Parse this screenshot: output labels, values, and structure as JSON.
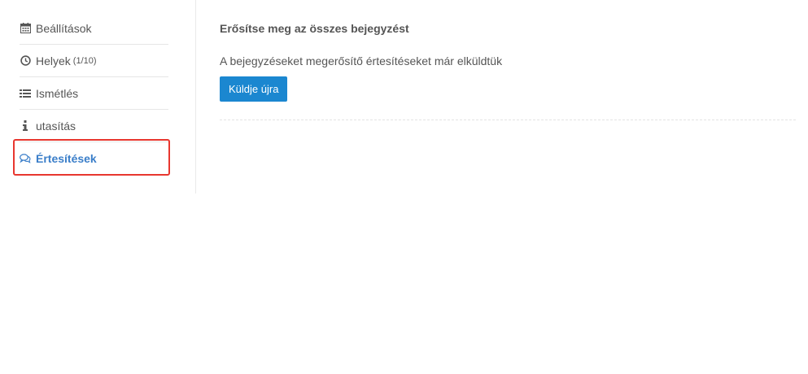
{
  "sidebar": {
    "items": [
      {
        "label": "Beállítások",
        "icon": "calendar-icon"
      },
      {
        "label": "Helyek",
        "count": "(1/10)",
        "icon": "clock-icon"
      },
      {
        "label": "Ismétlés",
        "icon": "list-icon"
      },
      {
        "label": "utasítás",
        "icon": "info-icon"
      },
      {
        "label": "Értesítések",
        "icon": "chat-icon",
        "active": true
      }
    ]
  },
  "main": {
    "title": "Erősítse meg az összes bejegyzést",
    "description": "A bejegyzéseket megerősítő értesítéseket már elküldtük",
    "resend_label": "Küldje újra"
  },
  "colors": {
    "accent": "#1b87d0",
    "active_link": "#3a7ec9",
    "highlight": "#e8372f"
  }
}
